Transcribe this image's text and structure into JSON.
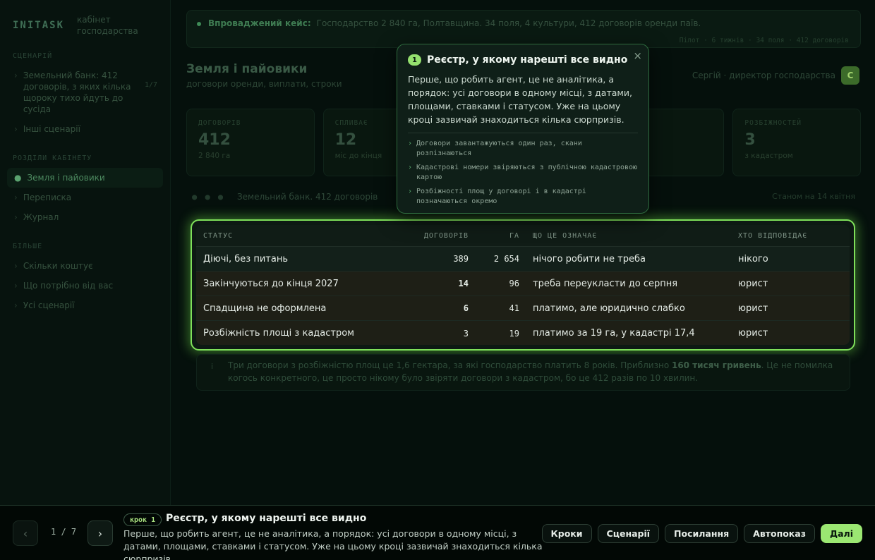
{
  "sidebar": {
    "brand": "INITASK",
    "brand_sub": "кабінет господарства",
    "sections": [
      {
        "title": "Сценарій"
      },
      {
        "title": "Розділи кабінету"
      },
      {
        "title": "Більше"
      }
    ],
    "scenario_item": {
      "label": "Земельний банк: 412 договорів, з яких кілька щороку тихо йдуть до сусіда",
      "count": "1/7"
    },
    "other_scenarios": "Інші сценарії",
    "nav": [
      {
        "label": "Земля і пайовики"
      },
      {
        "label": "Переписка"
      },
      {
        "label": "Журнал"
      }
    ],
    "more": [
      {
        "label": "Скільки коштує"
      },
      {
        "label": "Що потрібно від вас"
      },
      {
        "label": "Усі сценарії"
      }
    ]
  },
  "banner": {
    "label": "Впроваджений кейс:",
    "text": "Господарство 2 840 га, Полтавщина. 34 поля, 4 культури, 412 договорів оренди паїв.",
    "meta": "Пілот · 6 тижнів · 34 поля · 412 договорів"
  },
  "header": {
    "title": "Земля і пайовики",
    "subtitle": "договори оренди, виплати, строки",
    "user": "Сергій · директор господарства",
    "avatar": "С"
  },
  "cards": [
    {
      "label": "Договорів",
      "value": "412",
      "sub": "2 840 га"
    },
    {
      "label": "Спливає",
      "value": "12",
      "sub": "міс до кінця"
    },
    {
      "label": "",
      "value": "",
      "sub": ""
    },
    {
      "label": "",
      "value": "",
      "sub": ""
    },
    {
      "label": "Розбіжностей",
      "value": "3",
      "sub": "з кадастром"
    }
  ],
  "crumbs": {
    "dots": "● ● ●",
    "text": "Земельний банк. 412 договорів",
    "right": "Станом на 14 квітня"
  },
  "table": {
    "headers": [
      "Статус",
      "Договорів",
      "Га",
      "Що це означає",
      "Хто відповідає"
    ],
    "rows": [
      {
        "status": "Діючі, без питань",
        "contracts": "389",
        "ha": "2 654",
        "meaning": "нічого робити не треба",
        "owner": "нікого",
        "warn": false,
        "bold": false
      },
      {
        "status": "Закінчуються до кінця 2027",
        "contracts": "14",
        "ha": "96",
        "meaning": "треба переукласти до серпня",
        "owner": "юрист",
        "warn": true,
        "bold": true
      },
      {
        "status": "Спадщина не оформлена",
        "contracts": "6",
        "ha": "41",
        "meaning": "платимо, але юридично слабко",
        "owner": "юрист",
        "warn": true,
        "bold": true
      },
      {
        "status": "Розбіжність площі з кадастром",
        "contracts": "3",
        "ha": "19",
        "meaning": "платимо за 19 га, у кадастрі 17,4",
        "owner": "юрист",
        "warn": true,
        "bold": false
      }
    ]
  },
  "note": {
    "icon": "i",
    "text_before": "Три договори з розбіжністю площ це 1,6 гектара, за які господарство платить 8 років. Приблизно ",
    "highlight": "160 тисяч гривень",
    "text_after": ". Це не помилка когось конкретного, це просто нікому було звіряти договори з кадастром, бо це 412 разів по 10 хвилин."
  },
  "popover": {
    "number": "1",
    "title": "Реєстр, у якому нарешті все видно",
    "close": "×",
    "body": "Перше, що робить агент, це не аналітика, а порядок: усі договори в одному місці, з датами, площами, ставками і статусом. Уже на цьому кроці зазвичай знаходиться кілька сюрпризів.",
    "points": [
      "Договори завантажуються один раз, скани розпізнаються",
      "Кадастрові номери звіряються з публічною кадастровою картою",
      "Розбіжності площ у договорі і в кадастрі позначаються окремо"
    ]
  },
  "bottom": {
    "prev": "‹",
    "next": "›",
    "counter": "1 / 7",
    "step_tag": "крок 1",
    "step_title": "Реєстр, у якому нарешті все видно",
    "step_desc": "Перше, що робить агент, це не аналітика, а порядок: усі договори в одному місці, з датами, площами, ставками і статусом. Уже на цьому кроці зазвичай знаходиться кілька сюрпризів.",
    "buttons": {
      "steps": "Кроки",
      "scenarios": "Сценарії",
      "links": "Посилання",
      "autoplay": "Автопоказ",
      "next": "Далі"
    }
  },
  "colors": {
    "accent": "#9be772",
    "highlight": "#7fe05a",
    "background": "#05100c"
  }
}
